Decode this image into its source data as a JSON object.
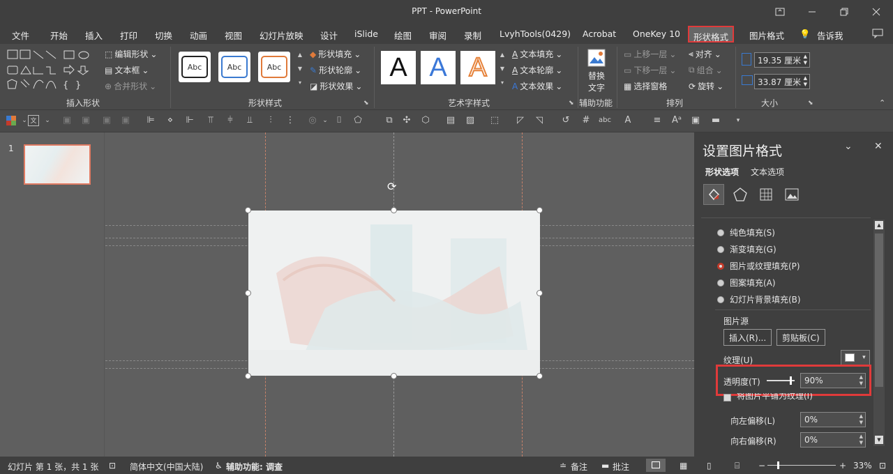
{
  "window": {
    "title": "PPT  -  PowerPoint"
  },
  "tabs": [
    {
      "label": "文件"
    },
    {
      "label": "开始"
    },
    {
      "label": "插入"
    },
    {
      "label": "打印"
    },
    {
      "label": "切换"
    },
    {
      "label": "动画"
    },
    {
      "label": "视图"
    },
    {
      "label": "幻灯片放映"
    },
    {
      "label": "设计"
    },
    {
      "label": "iSlide"
    },
    {
      "label": "绘图"
    },
    {
      "label": "审阅"
    },
    {
      "label": "录制"
    },
    {
      "label": "LvyhTools(0429)"
    },
    {
      "label": "Acrobat"
    },
    {
      "label": "OneKey 10"
    },
    {
      "label": "形状格式"
    },
    {
      "label": "图片格式"
    }
  ],
  "tell_me": "告诉我",
  "ribbon": {
    "insert_shapes": {
      "edit_shape": "编辑形状",
      "text_box": "文本框",
      "merge_shapes": "合并形状",
      "label": "插入形状"
    },
    "shape_styles": {
      "sample": "Abc",
      "fill": "形状填充",
      "outline": "形状轮廓",
      "effects": "形状效果",
      "label": "形状样式"
    },
    "wordart": {
      "letter": "A",
      "text_fill": "文本填充",
      "text_outline": "文本轮廓",
      "text_effects": "文本效果",
      "label": "艺术字样式"
    },
    "accessibility": {
      "alt_text_line1": "替换",
      "alt_text_line2": "文字",
      "label": "辅助功能"
    },
    "arrange": {
      "bring_forward": "上移一层",
      "send_backward": "下移一层",
      "selection_pane": "选择窗格",
      "align": "对齐",
      "group": "组合",
      "rotate": "旋转",
      "label": "排列"
    },
    "size": {
      "height": "19.35 厘米",
      "width": "33.87 厘米",
      "label": "大小"
    }
  },
  "thumbnail": {
    "number": "1"
  },
  "pane": {
    "title": "设置图片格式",
    "tab_shape": "形状选项",
    "tab_text": "文本选项",
    "fill_options": [
      {
        "label": "纯色填充(S)",
        "selected": false
      },
      {
        "label": "渐变填充(G)",
        "selected": false
      },
      {
        "label": "图片或纹理填充(P)",
        "selected": true
      },
      {
        "label": "图案填充(A)",
        "selected": false
      },
      {
        "label": "幻灯片背景填充(B)",
        "selected": false
      }
    ],
    "picture_source": "图片源",
    "insert_button": "插入(R)...",
    "clipboard_button": "剪贴板(C)",
    "texture_label": "纹理(U)",
    "transparency_label": "透明度(T)",
    "transparency_value": "90%",
    "transparency_level": 0.9,
    "tile_label": "将图片平铺为纹理(I)",
    "offset_left_label": "向左偏移(L)",
    "offset_left_value": "0%",
    "offset_right_label": "向右偏移(R)",
    "offset_right_value": "0%"
  },
  "status": {
    "slide_info": "幻灯片 第 1 张，共 1 张",
    "language": "简体中文(中国大陆)",
    "accessibility": "辅助功能: 调查",
    "notes": "备注",
    "comments": "批注",
    "zoom_minus": "−",
    "zoom_plus": "+",
    "zoom": "33%"
  },
  "colors": {
    "highlight": "#e03a3a",
    "radio_selected": "#c43b2b",
    "shape_outline_orange": "#e07a3a",
    "shape_outline_blue": "#3a7ad0",
    "wordart_blue": "#3b78d8",
    "wordart_orange": "#e6823a"
  }
}
